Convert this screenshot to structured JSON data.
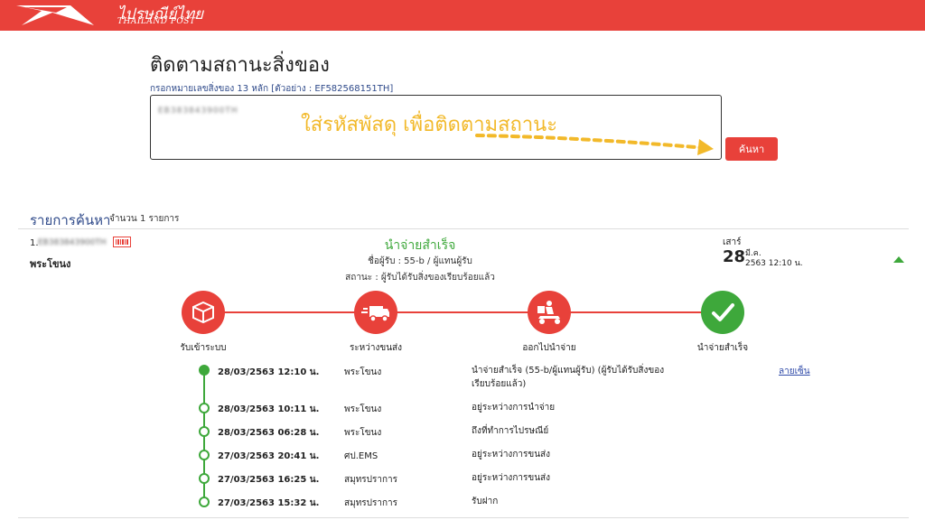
{
  "header": {
    "logo_th": "ไปรษณีย์ไทย",
    "logo_en": "THAILAND POST",
    "brand_color": "#e8413a"
  },
  "search": {
    "title": "ติดตามสถานะสิ่งของ",
    "hint": "กรอกหมายเลขสิ่งของ 13 หลัก [ตัวอย่าง : EF582568151TH]",
    "value": "EB383843900TH",
    "overlay": "ใส่รหัสพัสดุ เพื่อติดตามสถานะ",
    "button": "ค้นหา"
  },
  "results": {
    "title": "รายการค้นหา",
    "count": "จำนวน 1 รายการ",
    "item": {
      "index": "1.",
      "number": "EB383843900TH",
      "office": "พระโขนง",
      "status": "นำจ่ายสำเร็จ",
      "receiver": "ชื่อผู้รับ : 55-b / ผู้แทนผู้รับ",
      "status_detail": "สถานะ : ผู้รับได้รับสิ่งของเรียบร้อยแล้ว",
      "weekday": "เสาร์",
      "day": "28",
      "month": "มี.ค.",
      "year_time": "2563 12:10 น."
    },
    "steps": [
      {
        "label": "รับเข้าระบบ",
        "icon": "box-icon"
      },
      {
        "label": "ระหว่างขนส่ง",
        "icon": "truck-icon"
      },
      {
        "label": "ออกไปนำจ่าย",
        "icon": "scooter-icon"
      },
      {
        "label": "นำจ่ายสำเร็จ",
        "icon": "check-icon"
      }
    ],
    "timeline": [
      {
        "date": "28/03/2563 12:10 น.",
        "place": "พระโขนง",
        "desc": "นำจ่ายสำเร็จ (55-b/ผู้แทนผู้รับ) (ผู้รับได้รับสิ่งของเรียบร้อยแล้ว)"
      },
      {
        "date": "28/03/2563 10:11 น.",
        "place": "พระโขนง",
        "desc": "อยู่ระหว่างการนำจ่าย"
      },
      {
        "date": "28/03/2563 06:28 น.",
        "place": "พระโขนง",
        "desc": "ถึงที่ทำการไปรษณีย์"
      },
      {
        "date": "27/03/2563 20:41 น.",
        "place": "ศป.EMS",
        "desc": "อยู่ระหว่างการขนส่ง"
      },
      {
        "date": "27/03/2563 16:25 น.",
        "place": "สมุทรปราการ",
        "desc": "อยู่ระหว่างการขนส่ง"
      },
      {
        "date": "27/03/2563 15:32 น.",
        "place": "สมุทรปราการ",
        "desc": "รับฝาก"
      }
    ],
    "signature_link": "ลายเซ็น"
  }
}
